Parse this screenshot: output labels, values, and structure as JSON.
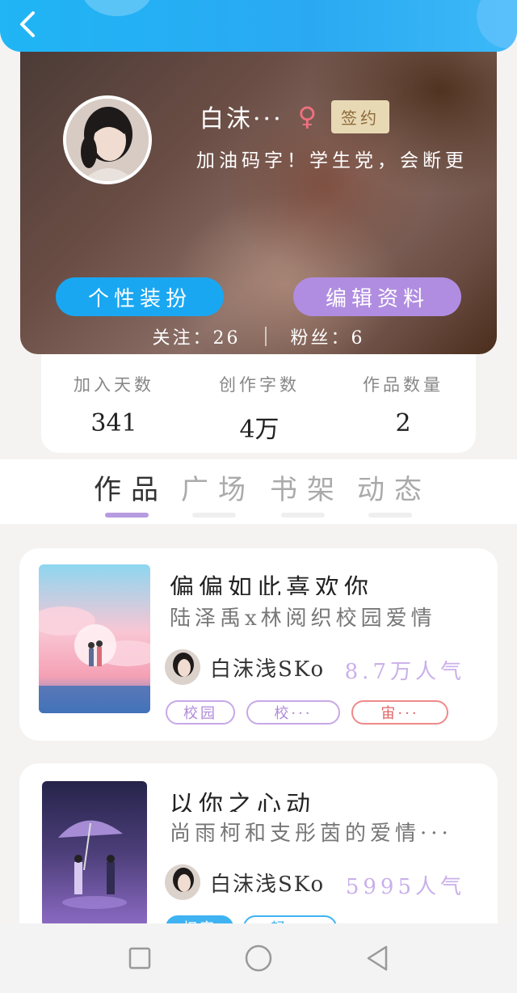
{
  "header": {
    "back_icon": "chevron-left-icon",
    "accent": "#20b5f5"
  },
  "profile": {
    "username": "白沫···",
    "gender_symbol": "♀",
    "signed_label": "签约",
    "bio": "加油码字！学生党，会断更",
    "dress_button": "个性装扮",
    "edit_button": "编辑资料",
    "following": "关注：26",
    "followers": "粉丝：6"
  },
  "stats": [
    {
      "label": "加入天数",
      "value": "341"
    },
    {
      "label": "创作字数",
      "value": "4万"
    },
    {
      "label": "作品数量",
      "value": "2"
    }
  ],
  "tabs": [
    "作品",
    "广场",
    "书架",
    "动态"
  ],
  "works": [
    {
      "title": "偏偏如此喜欢你",
      "desc": "陆泽禹x林阅织校园爱情",
      "author": "白沫浅SKo",
      "popularity": "8.7万人气",
      "tags": [
        "校园",
        "校···",
        "宙···"
      ]
    },
    {
      "title": "以你之心动",
      "desc": "尚雨柯和支彤茵的爱情···",
      "author": "白沫浅SKo",
      "popularity": "5995人气",
      "tags": [
        "权宠",
        "轻···"
      ]
    }
  ],
  "navbar": {
    "items": [
      "square-icon",
      "circle-icon",
      "triangle-back-icon"
    ]
  }
}
